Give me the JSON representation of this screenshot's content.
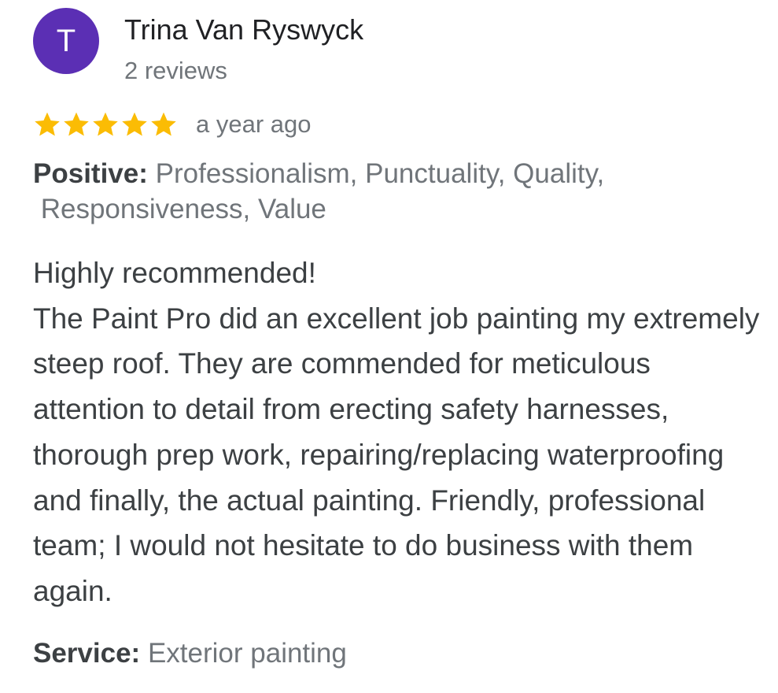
{
  "reviewer": {
    "initial": "T",
    "name": "Trina Van Ryswyck",
    "review_count": "2 reviews",
    "avatar_color": "#5b2fb4"
  },
  "rating": {
    "stars": 5,
    "max_stars": 5,
    "star_color": "#fbbc04",
    "icon": "star-icon",
    "time_ago": "a year ago"
  },
  "highlights": {
    "positive_label": "Positive:",
    "positive_values": "Professionalism, Punctuality, Quality,\n Responsiveness, Value"
  },
  "review": {
    "text": "Highly recommended!\nThe Paint Pro did an excellent job painting my extremely steep roof. They are commended for meticulous attention to detail from erecting safety harnesses,  thorough prep work, repairing/replacing waterproofing and finally, the actual painting. Friendly, professional team; I would not hesitate to do business with them again."
  },
  "service": {
    "label": "Service:",
    "value": "Exterior painting"
  }
}
